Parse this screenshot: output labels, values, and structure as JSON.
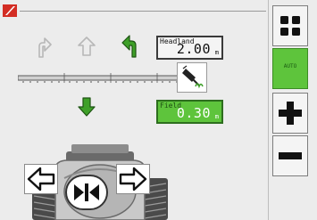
{
  "headland": {
    "label": "Headland",
    "value": "2.00",
    "unit": "m"
  },
  "field": {
    "label": "Field",
    "value": "0.30",
    "unit": "m"
  },
  "side_panel": {
    "auto_label": "AUTO"
  },
  "icons": {
    "logo": "lifter-logo-icon",
    "arrow_left_up": "curved-arrow-left-up-icon",
    "arrow_up": "arrow-up-icon",
    "arrow_right_up": "curved-arrow-right-up-icon",
    "arrow_down": "arrow-down-icon",
    "terrain": "terrain-sensor-icon",
    "grid": "grid-menu-icon",
    "plus": "plus-icon",
    "minus": "minus-icon",
    "left": "arrow-left-icon",
    "right": "arrow-right-icon",
    "center": "center-icon"
  },
  "colors": {
    "accent_green": "#5ec43c",
    "active_arrow": "#3ea028",
    "inactive_arrow": "#b7b7b7",
    "logo_red": "#d32d24"
  }
}
